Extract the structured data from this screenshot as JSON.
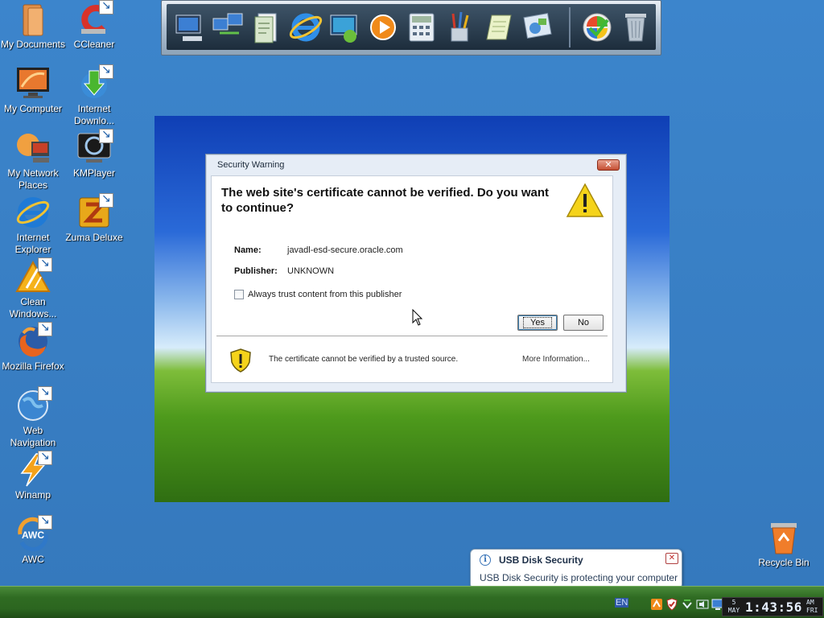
{
  "desktop": {
    "icons": [
      {
        "name": "my-documents",
        "label": "My Documents",
        "icon": "folder-icon"
      },
      {
        "name": "ccleaner",
        "label": "CCleaner",
        "icon": "ccleaner-icon"
      },
      {
        "name": "my-computer",
        "label": "My Computer",
        "icon": "monitor-icon"
      },
      {
        "name": "internet-download-manager",
        "label": "Internet Downlo...",
        "icon": "download-globe-icon"
      },
      {
        "name": "my-network-places",
        "label": "My Network Places",
        "icon": "network-icon"
      },
      {
        "name": "kmplayer",
        "label": "KMPlayer",
        "icon": "kmplayer-icon"
      },
      {
        "name": "internet-explorer",
        "label": "Internet Explorer",
        "icon": "ie-icon"
      },
      {
        "name": "zuma-deluxe",
        "label": "Zuma Deluxe",
        "icon": "zuma-icon"
      },
      {
        "name": "clean-windows",
        "label": "Clean Windows...",
        "icon": "broom-warning-icon"
      },
      {
        "name": "mozilla-firefox",
        "label": "Mozilla Firefox",
        "icon": "firefox-icon"
      },
      {
        "name": "web-navigation",
        "label": "Web Navigation",
        "icon": "globe-icon"
      },
      {
        "name": "winamp",
        "label": "Winamp",
        "icon": "winamp-icon"
      },
      {
        "name": "awc",
        "label": "AWC",
        "icon": "awc-icon"
      },
      {
        "name": "recycle-bin",
        "label": "Recycle Bin",
        "icon": "recycle-bin-icon"
      }
    ]
  },
  "dock": {
    "items": [
      "my-computer-icon",
      "network-icon",
      "documents-icon",
      "internet-explorer-icon",
      "media-center-icon",
      "media-player-icon",
      "calculator-icon",
      "paint-icon",
      "notepad-icon",
      "control-panel-icon",
      "windows-logo-icon",
      "trash-icon"
    ]
  },
  "dialog": {
    "title": "Security Warning",
    "close": "✕",
    "heading": "The web site's certificate cannot be verified. Do you want to continue?",
    "name_label": "Name:",
    "name_value": "javadl-esd-secure.oracle.com",
    "publisher_label": "Publisher:",
    "publisher_value": "UNKNOWN",
    "checkbox_label": "Always trust content from this publisher",
    "checkbox_checked": false,
    "yes_label": "Yes",
    "no_label": "No",
    "footer_text": "The certificate cannot be verified by a trusted source.",
    "more_info": "More Information..."
  },
  "balloon": {
    "title": "USB Disk Security",
    "text": "USB Disk Security is protecting your computer",
    "info": "i",
    "close": "✕"
  },
  "taskbar": {
    "language": "EN",
    "tray_icons": [
      "usb-security-icon",
      "shield-alert-icon",
      "network-arrow-icon",
      "volume-icon",
      "display-icon"
    ],
    "clock": {
      "day_num": "5",
      "month": "MAY",
      "time": "1:43:56",
      "ampm": "AM",
      "weekday": "FRI"
    }
  },
  "colors": {
    "desktop": "#3a7fc4",
    "taskbar": "#2f6b22",
    "dialog_close": "#c44f33",
    "warning_yellow": "#f5d31a"
  }
}
